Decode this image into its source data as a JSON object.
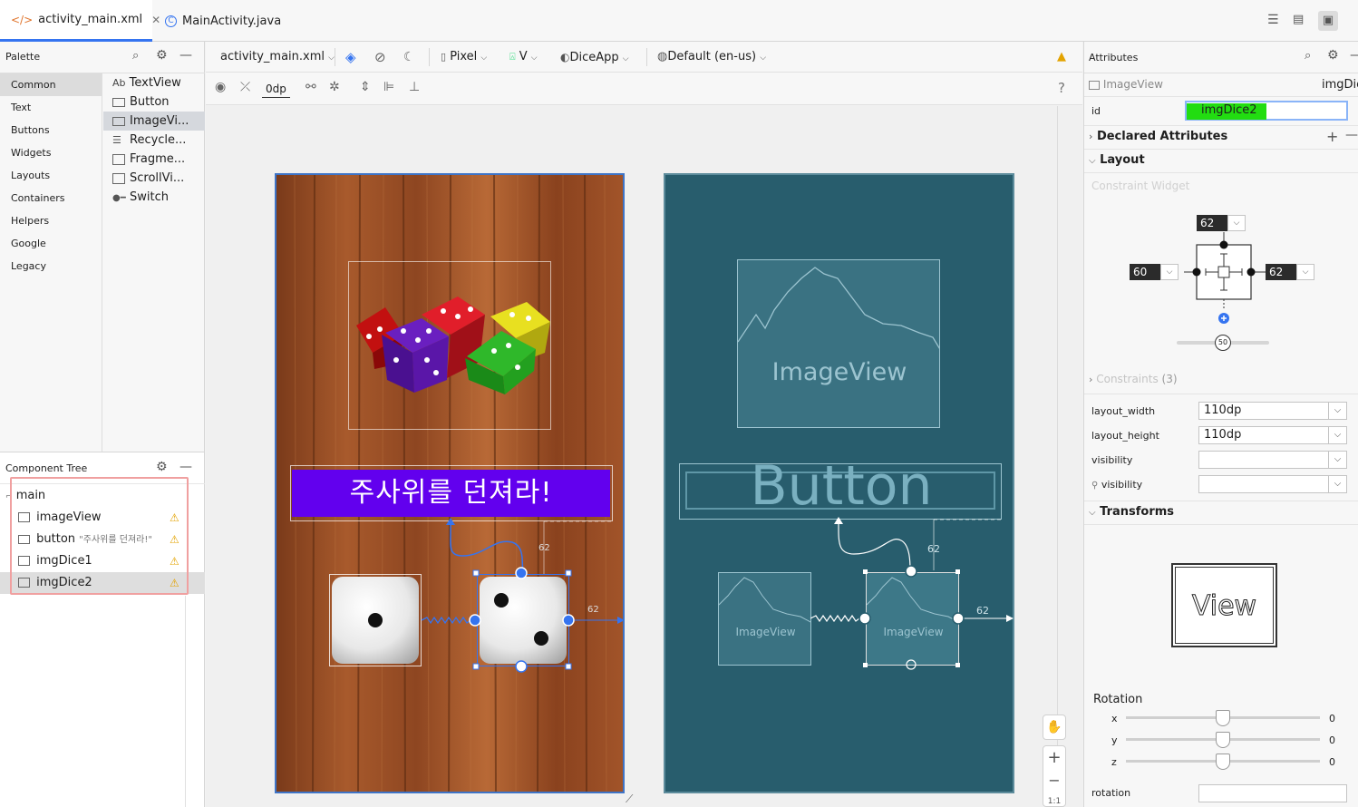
{
  "tabs": [
    {
      "label": "activity_main.xml",
      "icon": "xml-icon",
      "active": true
    },
    {
      "label": "MainActivity.java",
      "icon": "class-icon",
      "active": false
    }
  ],
  "palette": {
    "title": "Palette",
    "categories": [
      "Common",
      "Text",
      "Buttons",
      "Widgets",
      "Layouts",
      "Containers",
      "Helpers",
      "Google",
      "Legacy"
    ],
    "items": [
      "TextView",
      "Button",
      "ImageVi...",
      "Recycle...",
      "Fragme...",
      "ScrollVi...",
      "Switch"
    ],
    "textview_prefix": "Ab"
  },
  "tree": {
    "title": "Component Tree",
    "rows": [
      {
        "label": "main",
        "sub": "",
        "warn": false
      },
      {
        "label": "imageView",
        "sub": "",
        "warn": true
      },
      {
        "label": "button",
        "sub": "\"주사위를 던져라!\"",
        "warn": true
      },
      {
        "label": "imgDice1",
        "sub": "",
        "warn": true
      },
      {
        "label": "imgDice2",
        "sub": "",
        "warn": true
      }
    ]
  },
  "toolbar": {
    "file": "activity_main.xml",
    "margin": "0dp",
    "device": "Pixel",
    "api": "V",
    "theme": "DiceApp",
    "locale": "Default (en-us)",
    "help": "?"
  },
  "design": {
    "button_text": "주사위를 던져라!",
    "margin_label_top": "62",
    "margin_label_right": "62"
  },
  "blueprint": {
    "imageview_label": "ImageView",
    "button_label": "Button",
    "dice1_label": "ImageView",
    "dice2_label": "ImageView",
    "margin_label_top": "62",
    "margin_label_right": "62"
  },
  "attributes": {
    "title": "Attributes",
    "widget_type": "ImageView",
    "widget_id_short": "imgDic",
    "id_label": "id",
    "id_value": "imgDice2",
    "declared": "Declared Attributes",
    "layout": "Layout",
    "constraint_widget": "Constraint Widget",
    "margin_top": "62",
    "margin_left": "60",
    "margin_right": "62",
    "bias": "50",
    "constraints_label": "Constraints",
    "constraints_count": "(3)",
    "layout_width_label": "layout_width",
    "layout_width": "110dp",
    "layout_height_label": "layout_height",
    "layout_height": "110dp",
    "visibility_label": "visibility",
    "tools_visibility_label": "visibility",
    "transforms": "Transforms",
    "view_label": "View",
    "rotation_label": "Rotation",
    "axes": [
      {
        "axis": "x",
        "value": "0"
      },
      {
        "axis": "y",
        "value": "0"
      },
      {
        "axis": "z",
        "value": "0"
      }
    ],
    "rotation_field_label": "rotation"
  },
  "zoom": {
    "fit": "1:1"
  },
  "colors": {
    "accent": "#3574f0",
    "button_purple": "#6200ee",
    "blueprint_bg": "#285d6d",
    "id_highlight": "#22dd11",
    "warning": "#e3a300"
  }
}
